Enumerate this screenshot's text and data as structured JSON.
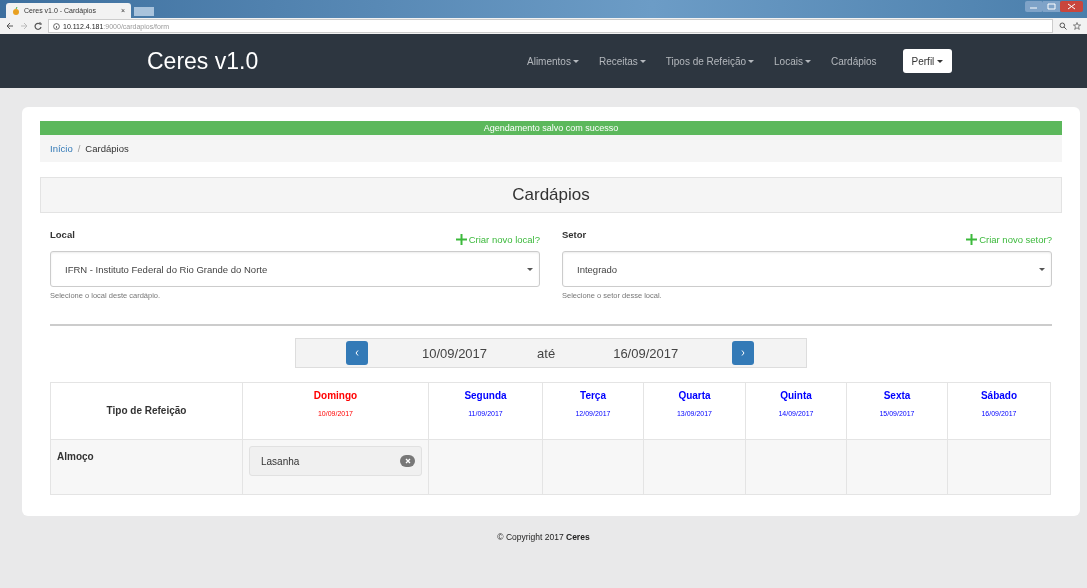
{
  "browser": {
    "tab_title": "Ceres v1.0 - Cardápios",
    "tab_close": "×",
    "url_host": "10.112.4.181",
    "url_rest": ":9000/cardapios/form"
  },
  "navbar": {
    "brand": "Ceres v1.0",
    "items": [
      {
        "label": "Alimentos",
        "dropdown": true
      },
      {
        "label": "Receitas",
        "dropdown": true
      },
      {
        "label": "Tipos de Refeição",
        "dropdown": true
      },
      {
        "label": "Locais",
        "dropdown": true
      },
      {
        "label": "Cardápios",
        "dropdown": false
      }
    ],
    "profile": "Perfil"
  },
  "alert": "Agendamento salvo com sucesso",
  "breadcrumb": [
    {
      "label": "Início",
      "link": true
    },
    {
      "label": "Cardápios",
      "link": false
    }
  ],
  "breadcrumb_separator": "/",
  "heading": "Cardápios",
  "fields": [
    {
      "label": "Local",
      "create": "Criar novo local?",
      "value": "IFRN - Instituto Federal do Rio Grande do Norte",
      "help": "Selecione o local deste cardápio."
    },
    {
      "label": "Setor",
      "create": "Criar novo setor?",
      "value": "Integrado",
      "help": "Selecione o setor desse local."
    }
  ],
  "week": {
    "start": "10/09/2017",
    "separator": "até",
    "end": "16/09/2017"
  },
  "table": {
    "corner": "Tipo de Refeição",
    "days": [
      {
        "name": "Domingo",
        "date": "10/09/2017",
        "color": "#ff0000"
      },
      {
        "name": "Segunda",
        "date": "11/09/2017",
        "color": "#0000ff"
      },
      {
        "name": "Terça",
        "date": "12/09/2017",
        "color": "#0000ff"
      },
      {
        "name": "Quarta",
        "date": "13/09/2017",
        "color": "#0000ff"
      },
      {
        "name": "Quinta",
        "date": "14/09/2017",
        "color": "#0000ff"
      },
      {
        "name": "Sexta",
        "date": "15/09/2017",
        "color": "#0000ff"
      },
      {
        "name": "Sábado",
        "date": "16/09/2017",
        "color": "#0000ff"
      }
    ],
    "rows": [
      {
        "meal": "Almoço",
        "cells": [
          [
            "Lasanha"
          ],
          [],
          [],
          [],
          [],
          [],
          []
        ]
      }
    ]
  },
  "footer": "© Copyright 2017 **Ceres**"
}
